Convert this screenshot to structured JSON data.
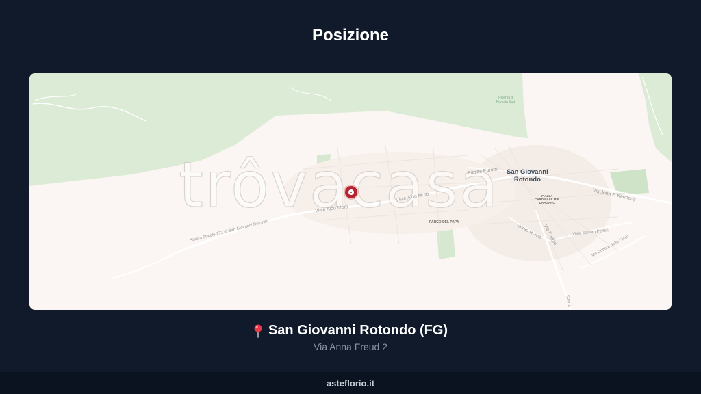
{
  "header": {
    "title": "Posizione"
  },
  "map": {
    "watermark": "trôvacasa",
    "town_name": "San Giovanni\nRotondo",
    "street_labels": [
      "Viale Aldo Moro",
      "Viale Aldo Moro",
      "Strada Statale 272 di San Giovanni Rotondo",
      "Piazza Europa",
      "Via John F. Kennedy",
      "Corso Roma",
      "Via Foggia",
      "Viale Sandro Pertini",
      "Via Dottore della Cimie",
      "Strada"
    ],
    "park_labels": [
      "Riserva di\nForesta Sudi",
      "PARCO DEL PAPA"
    ],
    "square_label": "PIAZZA\nCARDINALE M.P.\nDRAGANO",
    "marker_color": "#b62431"
  },
  "location": {
    "pin_icon": "round-pushpin-icon",
    "name": "San Giovanni Rotondo (FG)",
    "address": "Via Anna Freud 2"
  },
  "footer": {
    "site": "asteflorio.it"
  },
  "colors": {
    "background": "#111a2b",
    "footer": "#0c1320",
    "map_land": "#fbf6f3",
    "map_green": "#dcebd6"
  }
}
